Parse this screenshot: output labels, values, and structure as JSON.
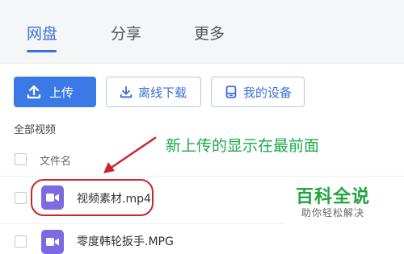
{
  "tabs": [
    {
      "label": "网盘",
      "active": true
    },
    {
      "label": "分享",
      "active": false
    },
    {
      "label": "更多",
      "active": false
    }
  ],
  "toolbar": {
    "upload_label": "上传",
    "offline_download_label": "离线下载",
    "my_devices_label": "我的设备"
  },
  "section_title": "全部视频",
  "file_list": {
    "column_header": "文件名",
    "files": [
      {
        "name": "视频素材.mp4",
        "icon": "video-file-icon"
      },
      {
        "name": "零度韩轮扳手.MPG",
        "icon": "video-file-icon"
      }
    ]
  },
  "annotation": "新上传的显示在最前面",
  "watermark": {
    "title": "百科全说",
    "subtitle": "助你轻松解决"
  },
  "colors": {
    "accent": "#3b6fd9",
    "primary_button": "#3b7ae6",
    "video_icon": "#7a6be0",
    "highlight": "#c8262c",
    "annotation": "#1ba84a",
    "watermark": "#1fa53f"
  }
}
